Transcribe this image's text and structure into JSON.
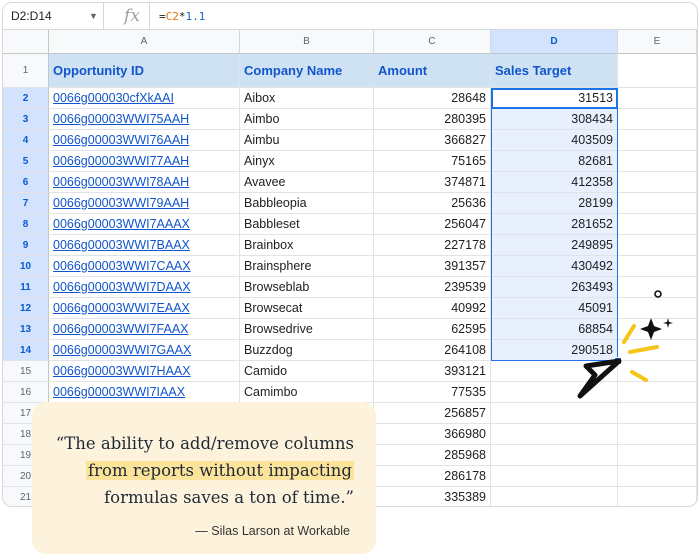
{
  "formula_bar": {
    "name_box": "D2:D14",
    "fx_label": "fx",
    "formula": {
      "prefix": "=",
      "ref": "C2",
      "op": "*",
      "num": "1.1"
    }
  },
  "columns": [
    "A",
    "B",
    "C",
    "D",
    "E"
  ],
  "header_row": {
    "row_number": "1",
    "labels": [
      "Opportunity ID",
      "Company Name",
      "Amount",
      "Sales Target",
      ""
    ]
  },
  "rows": [
    {
      "n": "2",
      "id": "0066g000030cfXkAAI",
      "company": "Aibox",
      "amount": "28648",
      "target": "31513"
    },
    {
      "n": "3",
      "id": "0066g00003WWI75AAH",
      "company": "Aimbo",
      "amount": "280395",
      "target": "308434"
    },
    {
      "n": "4",
      "id": "0066g00003WWI76AAH",
      "company": "Aimbu",
      "amount": "366827",
      "target": "403509"
    },
    {
      "n": "5",
      "id": "0066g00003WWI77AAH",
      "company": "Ainyx",
      "amount": "75165",
      "target": "82681"
    },
    {
      "n": "6",
      "id": "0066g00003WWI78AAH",
      "company": "Avavee",
      "amount": "374871",
      "target": "412358"
    },
    {
      "n": "7",
      "id": "0066g00003WWI79AAH",
      "company": "Babbleopia",
      "amount": "25636",
      "target": "28199"
    },
    {
      "n": "8",
      "id": "0066g00003WWI7AAAX",
      "company": "Babbleset",
      "amount": "256047",
      "target": "281652"
    },
    {
      "n": "9",
      "id": "0066g00003WWI7BAAX",
      "company": "Brainbox",
      "amount": "227178",
      "target": "249895"
    },
    {
      "n": "10",
      "id": "0066g00003WWI7CAAX",
      "company": "Brainsphere",
      "amount": "391357",
      "target": "430492"
    },
    {
      "n": "11",
      "id": "0066g00003WWI7DAAX",
      "company": "Browseblab",
      "amount": "239539",
      "target": "263493"
    },
    {
      "n": "12",
      "id": "0066g00003WWI7EAAX",
      "company": "Browsecat",
      "amount": "40992",
      "target": "45091"
    },
    {
      "n": "13",
      "id": "0066g00003WWI7FAAX",
      "company": "Browsedrive",
      "amount": "62595",
      "target": "68854"
    },
    {
      "n": "14",
      "id": "0066g00003WWI7GAAX",
      "company": "Buzzdog",
      "amount": "264108",
      "target": "290518"
    },
    {
      "n": "15",
      "id": "0066g00003WWI7HAAX",
      "company": "Camido",
      "amount": "393121",
      "target": ""
    },
    {
      "n": "16",
      "id": "0066g00003WWI7IAAX",
      "company": "Camimbo",
      "amount": "77535",
      "target": ""
    },
    {
      "n": "17",
      "id": "",
      "company": "",
      "amount": "256857",
      "target": ""
    },
    {
      "n": "18",
      "id": "",
      "company": "",
      "amount": "366980",
      "target": ""
    },
    {
      "n": "19",
      "id": "",
      "company": "",
      "amount": "285968",
      "target": ""
    },
    {
      "n": "20",
      "id": "",
      "company": "",
      "amount": "286178",
      "target": ""
    },
    {
      "n": "21",
      "id": "",
      "company": "",
      "amount": "335389",
      "target": ""
    }
  ],
  "quote": {
    "line1": "“The ability to add/remove columns",
    "line2": "from reports without impacting",
    "line3": "formulas saves a ton of time.”",
    "attribution": "— Silas Larson at Workable"
  },
  "colors": {
    "accent": "#1a73e8",
    "header_fill": "#cfe2f3",
    "selection_fill": "#e8f0fe",
    "quote_card": "#fdf3dc",
    "quote_highlight": "#fbe49a",
    "sparkle_yellow": "#f5c518"
  },
  "icons": [
    "chevron-down-icon",
    "cursor-arrow-icon",
    "sparkle-icon"
  ]
}
